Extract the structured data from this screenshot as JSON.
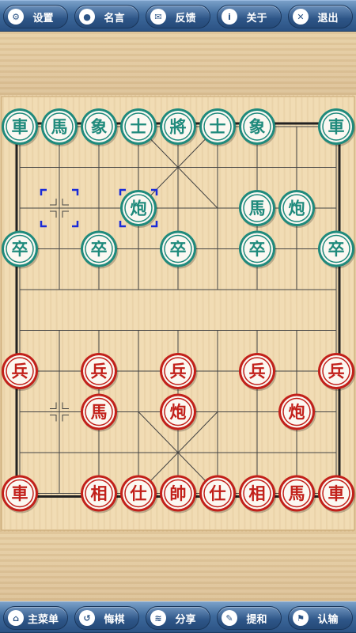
{
  "toolbar": {
    "settings": {
      "label": "设置",
      "icon": "gear-icon",
      "glyph": "⚙"
    },
    "quote": {
      "label": "名言",
      "icon": "speech-bubble-icon",
      "glyph": "●"
    },
    "feedback": {
      "label": "反馈",
      "icon": "mail-icon",
      "glyph": "✉"
    },
    "about": {
      "label": "关于",
      "icon": "info-icon",
      "glyph": "i"
    },
    "exit": {
      "label": "退出",
      "icon": "close-icon",
      "glyph": "✕"
    }
  },
  "bottombar": {
    "main_menu": {
      "label": "主菜单",
      "icon": "home-icon",
      "glyph": "⌂"
    },
    "undo": {
      "label": "悔棋",
      "icon": "undo-icon",
      "glyph": "↺"
    },
    "share": {
      "label": "分享",
      "icon": "rss-icon",
      "glyph": "≋"
    },
    "draw_offer": {
      "label": "提和",
      "icon": "pencil-icon",
      "glyph": "✎"
    },
    "resign": {
      "label": "认输",
      "icon": "flag-icon",
      "glyph": "⚑"
    }
  },
  "colors": {
    "board": "#f1dcb4",
    "line": "#444444",
    "green_piece": "#1f8a7c",
    "red_piece": "#c2201a",
    "piece_face": "#fbf8f2",
    "selection": "#1a2bd8"
  },
  "pieces": [
    {
      "side": "green",
      "char": "車",
      "col": 0,
      "row": 0
    },
    {
      "side": "green",
      "char": "馬",
      "col": 1,
      "row": 0
    },
    {
      "side": "green",
      "char": "象",
      "col": 2,
      "row": 0
    },
    {
      "side": "green",
      "char": "士",
      "col": 3,
      "row": 0
    },
    {
      "side": "green",
      "char": "將",
      "col": 4,
      "row": 0
    },
    {
      "side": "green",
      "char": "士",
      "col": 5,
      "row": 0
    },
    {
      "side": "green",
      "char": "象",
      "col": 6,
      "row": 0
    },
    {
      "side": "green",
      "char": "車",
      "col": 8,
      "row": 0
    },
    {
      "side": "green",
      "char": "炮",
      "col": 3,
      "row": 2
    },
    {
      "side": "green",
      "char": "馬",
      "col": 6,
      "row": 2
    },
    {
      "side": "green",
      "char": "炮",
      "col": 7,
      "row": 2
    },
    {
      "side": "green",
      "char": "卒",
      "col": 0,
      "row": 3
    },
    {
      "side": "green",
      "char": "卒",
      "col": 2,
      "row": 3
    },
    {
      "side": "green",
      "char": "卒",
      "col": 4,
      "row": 3
    },
    {
      "side": "green",
      "char": "卒",
      "col": 6,
      "row": 3
    },
    {
      "side": "green",
      "char": "卒",
      "col": 8,
      "row": 3
    },
    {
      "side": "red",
      "char": "兵",
      "col": 0,
      "row": 6
    },
    {
      "side": "red",
      "char": "兵",
      "col": 2,
      "row": 6
    },
    {
      "side": "red",
      "char": "兵",
      "col": 4,
      "row": 6
    },
    {
      "side": "red",
      "char": "兵",
      "col": 6,
      "row": 6
    },
    {
      "side": "red",
      "char": "兵",
      "col": 8,
      "row": 6
    },
    {
      "side": "red",
      "char": "馬",
      "col": 2,
      "row": 7
    },
    {
      "side": "red",
      "char": "炮",
      "col": 4,
      "row": 7
    },
    {
      "side": "red",
      "char": "炮",
      "col": 7,
      "row": 7
    },
    {
      "side": "red",
      "char": "車",
      "col": 0,
      "row": 9
    },
    {
      "side": "red",
      "char": "相",
      "col": 2,
      "row": 9
    },
    {
      "side": "red",
      "char": "仕",
      "col": 3,
      "row": 9
    },
    {
      "side": "red",
      "char": "帥",
      "col": 4,
      "row": 9
    },
    {
      "side": "red",
      "char": "仕",
      "col": 5,
      "row": 9
    },
    {
      "side": "red",
      "char": "相",
      "col": 6,
      "row": 9
    },
    {
      "side": "red",
      "char": "馬",
      "col": 7,
      "row": 9
    },
    {
      "side": "red",
      "char": "車",
      "col": 8,
      "row": 9
    }
  ],
  "last_move": {
    "from": {
      "col": 1,
      "row": 2
    },
    "to": {
      "col": 3,
      "row": 2
    }
  },
  "position_marks": [
    {
      "col": 1,
      "row": 2
    },
    {
      "col": 1,
      "row": 7
    }
  ]
}
